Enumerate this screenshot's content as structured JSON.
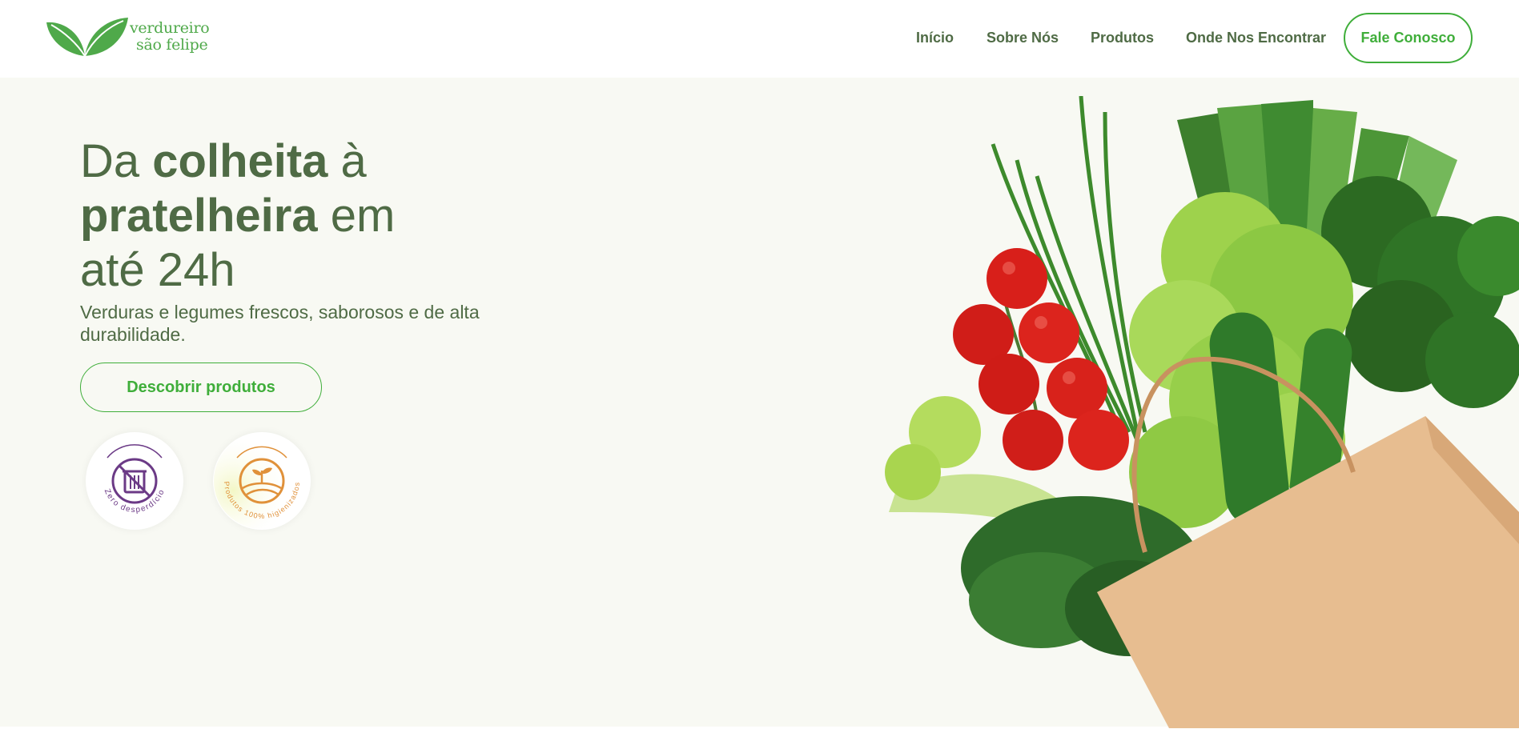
{
  "brand": {
    "name_line1": "verdureiro",
    "name_line2": "são felipe",
    "color": "#4fa94a"
  },
  "nav": {
    "items": [
      {
        "label": "Início"
      },
      {
        "label": "Sobre Nós"
      },
      {
        "label": "Produtos"
      },
      {
        "label": "Onde Nos Encontrar"
      }
    ],
    "cta_label": "Fale Conosco"
  },
  "hero": {
    "headline": {
      "p1": "Da ",
      "p2": "colheita",
      "p3": " à",
      "p4": "pratelheira",
      "p5": " em",
      "p6": "até 24h"
    },
    "subtitle": "Verduras e legumes frescos, saborosos e de alta durabilidade.",
    "button_label": "Descobrir produtos",
    "badges": [
      {
        "text": "Zero desperdício",
        "icon": "no-trash-icon",
        "color": "#6b3a86"
      },
      {
        "text": "Produtos 100% higienizados",
        "icon": "field-sprout-icon",
        "color": "#e0913a"
      }
    ],
    "image": "vegetables-in-paper-bag"
  },
  "colors": {
    "primary_green": "#3fae3a",
    "text_green": "#4f6b45",
    "hero_bg": "#f8f9f3"
  }
}
